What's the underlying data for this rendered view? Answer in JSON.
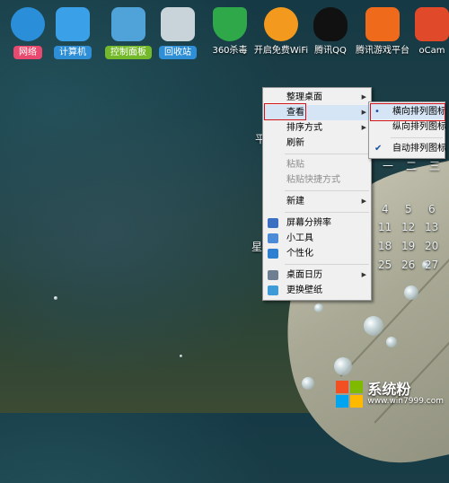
{
  "desktop": {
    "icons": [
      {
        "label": "网络",
        "chip_color": "#e84a6f",
        "glyph_color": "#2a8fd8",
        "icon": "network-globe-icon"
      },
      {
        "label": "计算机",
        "chip_color": "#2f8fd6",
        "glyph_color": "#3aa0e8",
        "icon": "computer-monitor-icon"
      },
      {
        "label": "控制面板",
        "chip_color": "#74b82b",
        "glyph_color": "#4fa3d9",
        "icon": "control-panel-icon"
      },
      {
        "label": "回收站",
        "chip_color": "#2f8fd6",
        "glyph_color": "#c8d4da",
        "icon": "recycle-bin-icon"
      },
      {
        "label": "360杀毒",
        "chip_color": "",
        "glyph_color": "#2fa84a",
        "icon": "antivirus-shield-icon"
      },
      {
        "label": "开启免费WiFi",
        "chip_color": "",
        "glyph_color": "#f39a1e",
        "icon": "wifi-icon"
      },
      {
        "label": "腾讯QQ",
        "chip_color": "",
        "glyph_color": "#111111",
        "icon": "qq-penguin-icon"
      },
      {
        "label": "腾讯游戏平台",
        "chip_color": "",
        "glyph_color": "#f06a1c",
        "icon": "game-platform-icon"
      },
      {
        "label": "oCam",
        "chip_color": "",
        "glyph_color": "#e04a2a",
        "icon": "ocam-icon"
      }
    ]
  },
  "calendar": {
    "header_left": "平",
    "header_right": [
      "一",
      "二",
      "三"
    ],
    "weekday_label": "星",
    "days": [
      "4",
      "5",
      "6",
      "11",
      "12",
      "13",
      "18",
      "19",
      "20",
      "25",
      "26",
      "27"
    ]
  },
  "context_menu": {
    "items": [
      {
        "label": "整理桌面",
        "submenu": true
      },
      {
        "label": "查看",
        "submenu": true,
        "highlighted": true
      },
      {
        "label": "排序方式",
        "submenu": true
      },
      {
        "label": "刷新"
      },
      {
        "sep": true
      },
      {
        "label": "粘贴",
        "disabled": true
      },
      {
        "label": "粘贴快捷方式",
        "disabled": true
      },
      {
        "sep": true
      },
      {
        "label": "新建",
        "submenu": true
      },
      {
        "sep": true
      },
      {
        "label": "屏幕分辨率",
        "icon_color": "#3b6fc2"
      },
      {
        "label": "小工具",
        "icon_color": "#4a8ad6"
      },
      {
        "label": "个性化",
        "icon_color": "#2f7fd0"
      },
      {
        "sep": true
      },
      {
        "label": "桌面日历",
        "submenu": true,
        "icon_color": "#6f7f92"
      },
      {
        "label": "更换壁纸",
        "icon_color": "#3f9ad8"
      }
    ]
  },
  "submenu": {
    "items": [
      {
        "label": "横向排列图标",
        "mark": "•",
        "highlighted": true
      },
      {
        "label": "纵向排列图标",
        "mark": ""
      },
      {
        "sep": true
      },
      {
        "label": "自动排列图标",
        "mark": "✔"
      }
    ]
  },
  "watermark": {
    "text": "系统粉",
    "url": "www.win7999.com",
    "tile_colors": [
      "#f25022",
      "#7fba00",
      "#00a4ef",
      "#ffb900"
    ]
  }
}
